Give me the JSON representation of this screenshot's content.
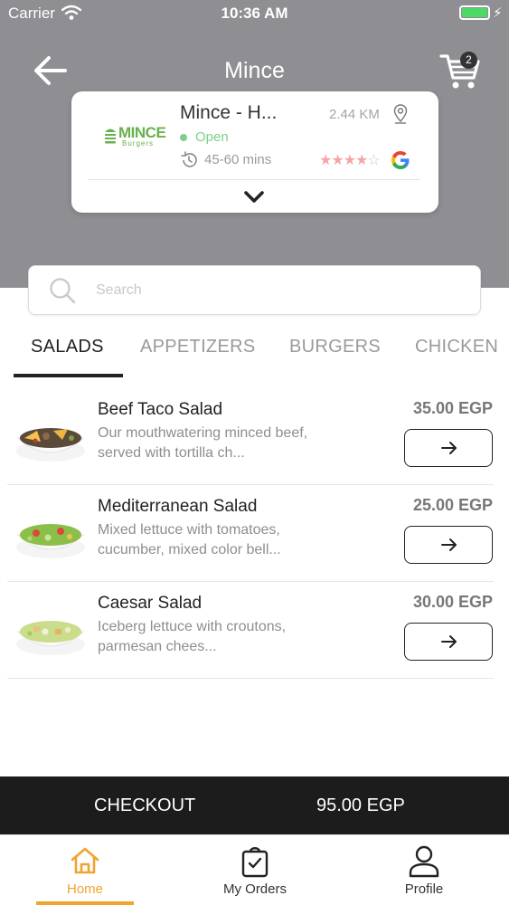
{
  "status_bar": {
    "carrier": "Carrier",
    "time": "10:36 AM"
  },
  "nav": {
    "title": "Mince",
    "cart_count": "2"
  },
  "restaurant": {
    "logo_text": "MINCE",
    "logo_subtext": "Burgers",
    "name": "Mince - H...",
    "status": "Open",
    "delivery_time": "45-60 mins",
    "distance": "2.44 KM",
    "rating_stars": 4,
    "rating_max": 5,
    "status_color": "#7ccf8c"
  },
  "search": {
    "placeholder": "Search",
    "value": ""
  },
  "categories": {
    "active_index": 0,
    "tabs": [
      {
        "label": "SALADS"
      },
      {
        "label": "APPETIZERS"
      },
      {
        "label": "BURGERS"
      },
      {
        "label": "CHICKEN"
      }
    ]
  },
  "menu_items": [
    {
      "name": "Beef Taco Salad",
      "description": "Our mouthwatering minced beef, served with tortilla ch...",
      "price": "35.00 EGP",
      "image": "beef-taco-salad"
    },
    {
      "name": "Mediterranean Salad",
      "description": "Mixed lettuce with tomatoes, cucumber, mixed color bell...",
      "price": "25.00 EGP",
      "image": "mediterranean-salad"
    },
    {
      "name": "Caesar Salad",
      "description": "Iceberg lettuce with croutons, parmesan chees...",
      "price": "30.00 EGP",
      "image": "caesar-salad"
    }
  ],
  "checkout": {
    "label": "CHECKOUT",
    "total": "95.00 EGP"
  },
  "tabbar": {
    "active": "home",
    "items": [
      {
        "label": "Home",
        "icon": "home-icon"
      },
      {
        "label": "My Orders",
        "icon": "orders-bag-icon"
      },
      {
        "label": "Profile",
        "icon": "profile-icon"
      }
    ]
  },
  "colors": {
    "header_bg": "#8e8e93",
    "accent": "#f0a32f",
    "open_green": "#7ccf8c",
    "logo_green": "#6ab04c",
    "checkout_bg": "#1c1c1c"
  }
}
